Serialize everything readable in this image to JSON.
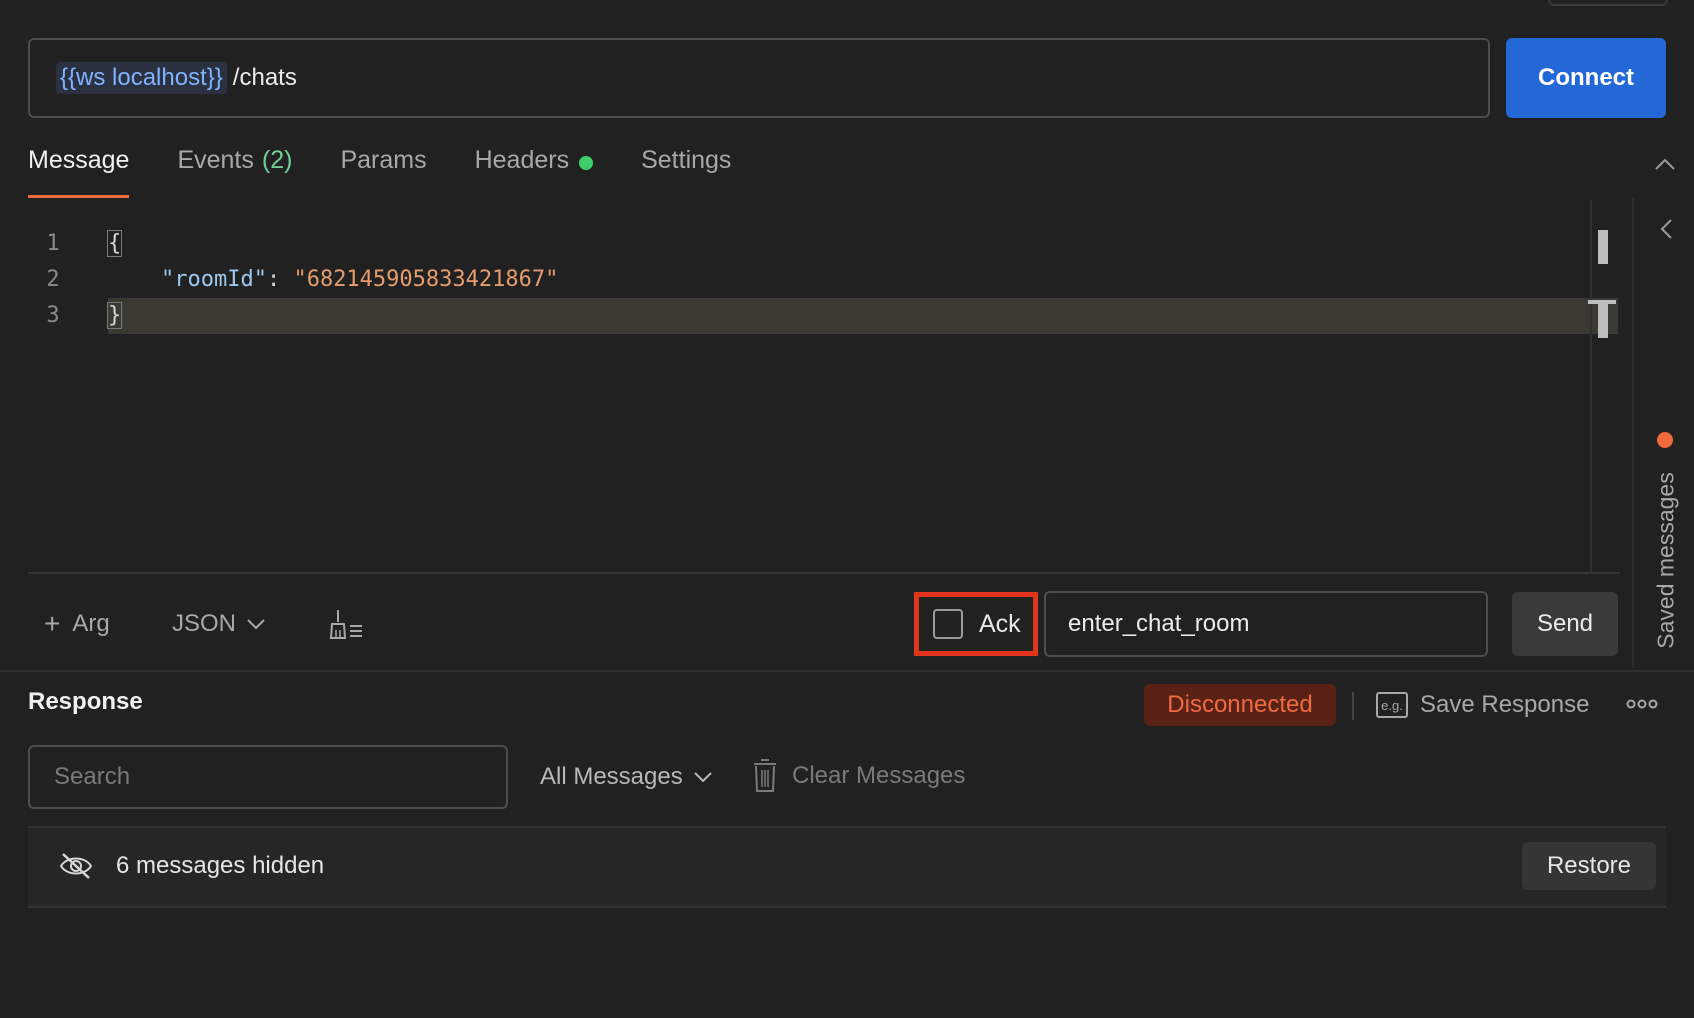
{
  "request": {
    "url_variable": "{{ws localhost}}",
    "url_path": "/chats",
    "connect_label": "Connect"
  },
  "tabs": [
    {
      "label": "Message",
      "active": true
    },
    {
      "label": "Events",
      "count": "(2)"
    },
    {
      "label": "Params"
    },
    {
      "label": "Headers",
      "indicator_color": "#3ecf6a"
    },
    {
      "label": "Settings"
    }
  ],
  "editor": {
    "line_numbers": [
      "1",
      "2",
      "3"
    ],
    "open_brace": "{",
    "key": "\"roomId\"",
    "colon": ": ",
    "value": "\"682145905833421867\"",
    "close_brace": "}"
  },
  "sidebar": {
    "saved_messages_label": "Saved messages"
  },
  "toolbar": {
    "arg_label": "Arg",
    "format_label": "JSON",
    "ack_label": "Ack",
    "ack_checked": false,
    "event_name_value": "enter_chat_room",
    "send_label": "Send"
  },
  "response": {
    "title": "Response",
    "status": "Disconnected",
    "save_response_label": "Save Response",
    "eg_icon_text": "e.g.",
    "search_placeholder": "Search",
    "filter_label": "All Messages",
    "clear_label": "Clear Messages",
    "hidden_text": "6 messages hidden",
    "restore_label": "Restore"
  },
  "colors": {
    "accent": "#ef6a3d",
    "primary_button": "#2468d8",
    "status_bg": "#5a2216",
    "highlight_border": "#e0341f"
  }
}
